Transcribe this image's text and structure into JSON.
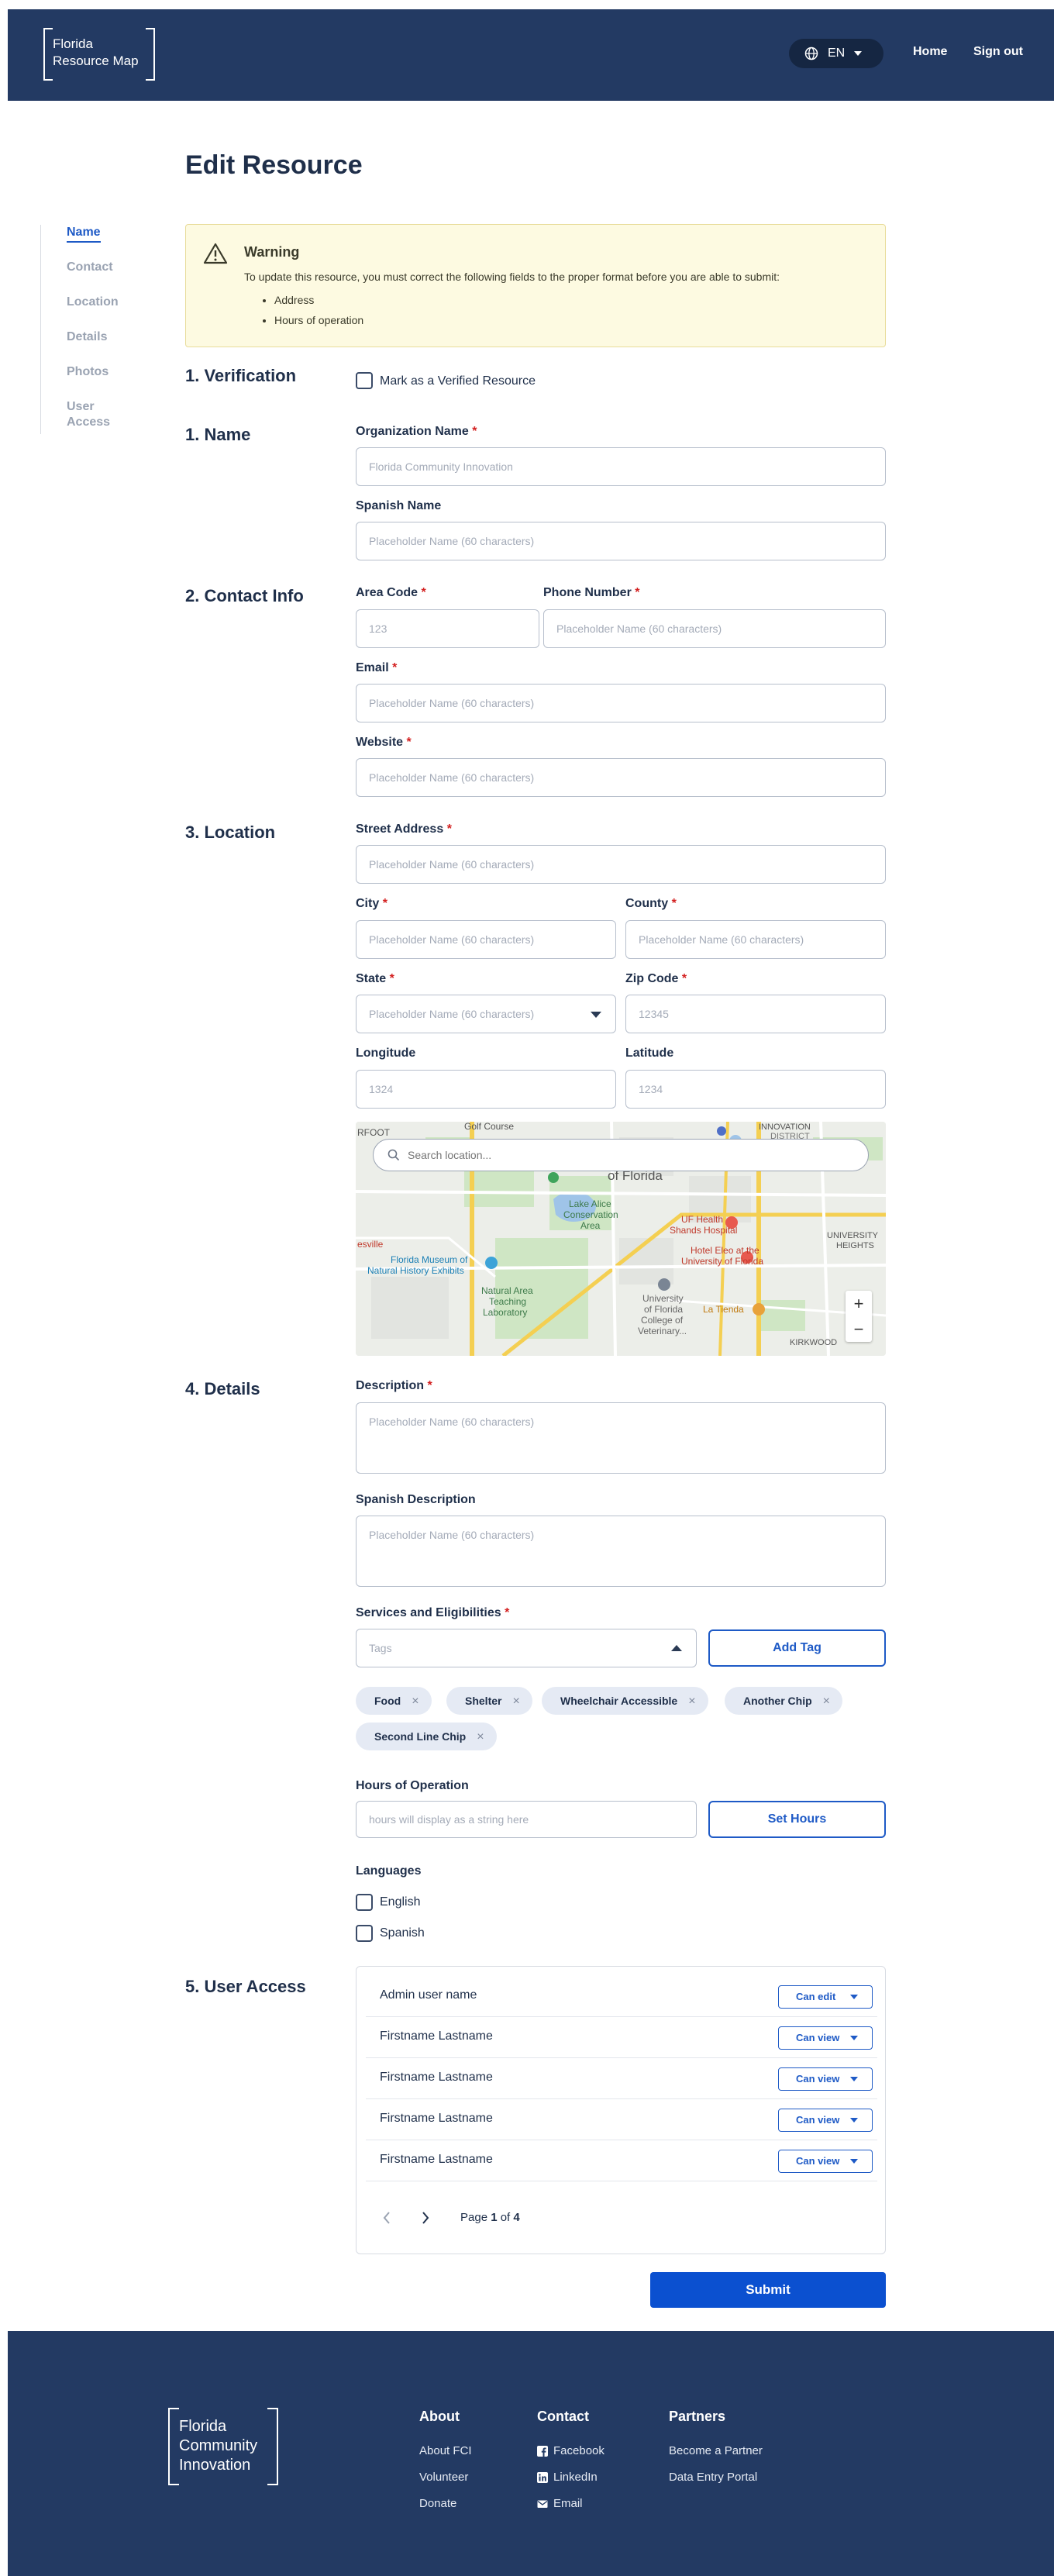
{
  "header": {
    "logo_line1": "Florida",
    "logo_line2": "Resource Map",
    "language": "EN",
    "nav_home": "Home",
    "nav_signout": "Sign out"
  },
  "page_title": "Edit Resource",
  "sidebar": {
    "items": [
      {
        "label": "Name",
        "active": true
      },
      {
        "label": "Contact"
      },
      {
        "label": "Location"
      },
      {
        "label": "Details"
      },
      {
        "label": "Photos"
      },
      {
        "label": "User Access"
      }
    ]
  },
  "warning": {
    "title": "Warning",
    "text": "To update this resource, you must correct the following fields to the proper format before you are able to submit:",
    "items": [
      "Address",
      "Hours of operation"
    ]
  },
  "verification": {
    "title": "1. Verification",
    "checkbox_label": "Mark as a Verified Resource"
  },
  "name_section": {
    "title": "1. Name",
    "org_label": "Organization Name",
    "org_placeholder": "Florida Community Innovation",
    "spanish_label": "Spanish Name",
    "spanish_placeholder": "Placeholder Name (60 characters)"
  },
  "contact": {
    "title": "2. Contact Info",
    "area_label": "Area Code",
    "area_placeholder": "123",
    "phone_label": "Phone Number",
    "phone_placeholder": "Placeholder Name (60 characters)",
    "email_label": "Email",
    "email_placeholder": "Placeholder Name (60 characters)",
    "website_label": "Website",
    "website_placeholder": "Placeholder Name (60 characters)"
  },
  "location": {
    "title": "3. Location",
    "street_label": "Street Address",
    "street_placeholder": "Placeholder Name (60 characters)",
    "city_label": "City",
    "city_placeholder": "Placeholder Name (60 characters)",
    "county_label": "County",
    "county_placeholder": "Placeholder Name (60 characters)",
    "state_label": "State",
    "state_placeholder": "Placeholder Name (60 characters)",
    "zip_label": "Zip Code",
    "zip_placeholder": "12345",
    "longitude_label": "Longitude",
    "longitude_placeholder": "1324",
    "latitude_label": "Latitude",
    "latitude_placeholder": "1234",
    "map_search_placeholder": "Search location...",
    "map_labels": {
      "golf": "Golf Course",
      "innovation": "INNOVATION",
      "district": "DISTRICT",
      "rfoot": "RFOOT",
      "of_florida": "of Florida",
      "lake_alice": "Lake Alice",
      "conservation": "Conservation",
      "area": "Area",
      "uf_health": "UF Health",
      "shands": "Shands Hospital",
      "museum1": "Florida Museum of",
      "museum2": "Natural History Exhibits",
      "hotel1": "Hotel Eleo at the",
      "hotel2": "University of Florida",
      "university": "UNIVERSITY",
      "heights": "HEIGHTS",
      "nat1": "Natural Area",
      "nat2": "Teaching",
      "nat3": "Laboratory",
      "uf1": "University",
      "uf2": "of Florida",
      "uf3": "College of",
      "uf4": "Veterinary...",
      "latienda": "La Tienda",
      "kirkwood": "KIRKWOOD",
      "esville": "esville",
      "zoom_in": "+",
      "zoom_out": "−"
    }
  },
  "details": {
    "title": "4. Details",
    "desc_label": "Description",
    "desc_placeholder": "Placeholder Name (60 characters)",
    "spanish_desc_label": "Spanish Description",
    "spanish_desc_placeholder": "Placeholder Name (60 characters)",
    "services_label": "Services and Eligibilities",
    "tags_placeholder": "Tags",
    "add_tag": "Add Tag",
    "chips": [
      "Food",
      "Shelter",
      "Wheelchair Accessible",
      "Another Chip",
      "Second Line Chip"
    ],
    "chip_remove": "×",
    "hours_label": "Hours of Operation",
    "hours_placeholder": "hours will display as a string here",
    "set_hours": "Set Hours",
    "languages_label": "Languages",
    "languages": [
      "English",
      "Spanish"
    ]
  },
  "user_access": {
    "title": "5. User Access",
    "rows": [
      {
        "name": "Admin user name",
        "permission": "Can edit"
      },
      {
        "name": "Firstname Lastname",
        "permission": "Can view"
      },
      {
        "name": "Firstname Lastname",
        "permission": "Can view"
      },
      {
        "name": "Firstname Lastname",
        "permission": "Can view"
      },
      {
        "name": "Firstname Lastname",
        "permission": "Can view"
      }
    ],
    "page_prefix": "Page ",
    "page_current": "1",
    "page_of": " of ",
    "page_total": "4"
  },
  "submit": "Submit",
  "footer": {
    "logo_line1": "Florida",
    "logo_line2": "Community",
    "logo_line3": "Innovation",
    "about_title": "About",
    "about_links": [
      "About FCI",
      "Volunteer",
      "Donate"
    ],
    "contact_title": "Contact",
    "contact_links": [
      "Facebook",
      "LinkedIn",
      "Email"
    ],
    "partners_title": "Partners",
    "partners_links": [
      "Become a Partner",
      "Data Entry Portal"
    ]
  },
  "colors": {
    "header_bg": "#233a63",
    "accent": "#1e5ac6",
    "submit_bg": "#0b50d0",
    "warning_bg": "#fdfae1",
    "required": "#d32020"
  }
}
